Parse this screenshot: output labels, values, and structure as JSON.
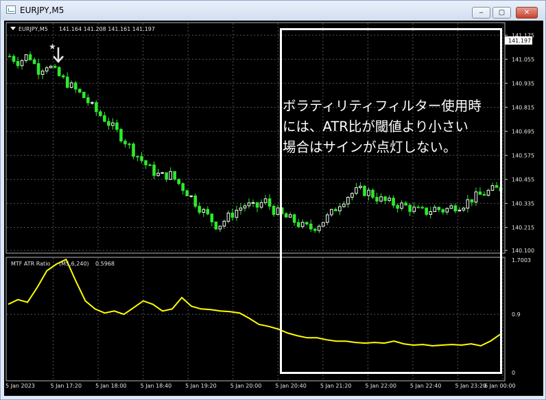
{
  "window": {
    "title": "EURJPY,M5",
    "minimize_label": "‒",
    "maximize_label": "▢",
    "close_label": "✕"
  },
  "main_chart": {
    "symbol": "EURJPY,M5",
    "ohlc": "141.164 141.208 141.161 141.197",
    "current_price": "141.197",
    "price_ticks": [
      "141.175",
      "141.055",
      "140.935",
      "140.815",
      "140.695",
      "140.575",
      "140.455",
      "140.335",
      "140.215",
      "140.100"
    ],
    "signal_marker_icon": "arrow-down-icon",
    "star_marker_icon": "star-icon"
  },
  "indicator": {
    "name": "MTF ATR Ratio",
    "params": "(M5,6,240)",
    "value": "0.5968",
    "ticks": [
      "1.7003",
      "0.9",
      "0"
    ]
  },
  "time_axis": {
    "labels": [
      "5 Jan 2023",
      "5 Jan 17:20",
      "5 Jan 18:00",
      "5 Jan 18:40",
      "5 Jan 19:20",
      "5 Jan 20:00",
      "5 Jan 20:40",
      "5 Jan 21:20",
      "5 Jan 22:00",
      "5 Jan 22:40",
      "5 Jan 23:20",
      "6 Jan 00:00"
    ]
  },
  "annotation": {
    "lines": [
      "ボラティリティフィルター使用時",
      "には、ATR比が閾値より小さい",
      "場合はサインが点灯しない。"
    ]
  },
  "colors": {
    "background": "#000000",
    "bull_candle": "#ffffff",
    "candle_green": "#2ee82e",
    "atr_line": "#ffff00",
    "grid": "#4a4a4a"
  },
  "chart_data": [
    {
      "type": "candlestick",
      "title": "EURJPY,M5",
      "x": [
        "5 Jan 2023",
        "5 Jan 17:20",
        "5 Jan 18:00",
        "5 Jan 18:40",
        "5 Jan 19:20",
        "5 Jan 20:00",
        "5 Jan 20:40",
        "5 Jan 21:20",
        "5 Jan 22:00",
        "5 Jan 22:40",
        "5 Jan 23:20",
        "6 Jan 00:00"
      ],
      "ylim": [
        140.1,
        141.2
      ],
      "grid": true,
      "close_profile": [
        141.07,
        141.04,
        141.08,
        141.0,
        141.03,
        140.98,
        140.94,
        140.9,
        140.86,
        140.8,
        140.76,
        140.71,
        140.66,
        140.6,
        140.55,
        140.5,
        140.47,
        140.48,
        140.43,
        140.38,
        140.32,
        140.27,
        140.22,
        140.26,
        140.3,
        140.33,
        140.31,
        140.35,
        140.3,
        140.27,
        140.25,
        140.22,
        140.21,
        140.24,
        140.28,
        140.34,
        140.38,
        140.4,
        140.39,
        140.36,
        140.34,
        140.33,
        140.32,
        140.3,
        140.29,
        140.31,
        140.3,
        140.32,
        140.33,
        140.36,
        140.38,
        140.4,
        140.41
      ]
    },
    {
      "type": "line",
      "title": "MTF ATR Ratio",
      "ylim": [
        0,
        1.7003
      ],
      "series": [
        {
          "name": "MTF ATR Ratio",
          "values": [
            1.05,
            1.12,
            1.08,
            1.3,
            1.55,
            1.65,
            1.72,
            1.4,
            1.1,
            0.98,
            0.92,
            0.95,
            0.9,
            1.0,
            1.1,
            1.05,
            0.95,
            0.98,
            1.15,
            1.02,
            0.98,
            0.97,
            0.95,
            0.94,
            0.92,
            0.84,
            0.75,
            0.72,
            0.68,
            0.62,
            0.58,
            0.55,
            0.55,
            0.52,
            0.5,
            0.5,
            0.48,
            0.47,
            0.48,
            0.47,
            0.5,
            0.46,
            0.44,
            0.45,
            0.43,
            0.44,
            0.45,
            0.44,
            0.46,
            0.43,
            0.5,
            0.6
          ]
        }
      ]
    }
  ]
}
